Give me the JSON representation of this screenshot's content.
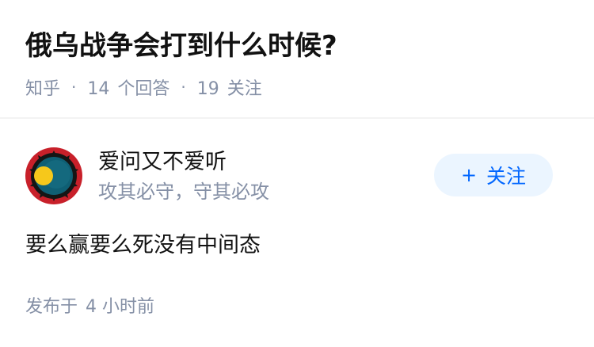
{
  "question": {
    "title": "俄乌战争会打到什么时候?",
    "source": "知乎",
    "separator": "·",
    "answer_count": "14",
    "answer_label": "个回答",
    "follower_count": "19",
    "follower_label": "关注"
  },
  "answer": {
    "author": {
      "name": "爱问又不爱听",
      "bio": "攻其必守，守其必攻",
      "avatar_icon": "sun-emblem-avatar-icon"
    },
    "follow_button": {
      "icon": "+",
      "label": "关注"
    },
    "content": "要么赢要么死没有中间态",
    "published_prefix": "发布于",
    "published_time": "4 小时前"
  },
  "colors": {
    "primary_text": "#121212",
    "secondary_text": "#8590a6",
    "accent_blue": "#0066ff",
    "follow_button_bg": "#ebf5ff",
    "avatar_red": "#c8202a",
    "avatar_teal": "#0f5f74",
    "avatar_sun": "#f6c81b"
  }
}
